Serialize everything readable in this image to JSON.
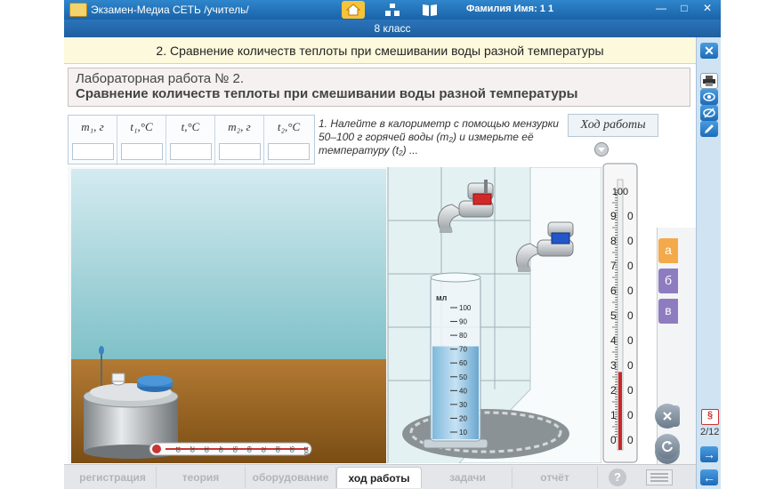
{
  "titlebar": {
    "app_title": "Экзамен-Медиа СЕТЬ /учитель/",
    "user_label": "Фамилия Имя:  1 1",
    "icons": [
      "home-icon",
      "structure-icon",
      "book-icon"
    ],
    "minimize": "—",
    "maximize": "□",
    "close": "✕"
  },
  "class_label": "8 класс",
  "topic": "2. Сравнение количеств теплоты при смешивании воды разной температуры",
  "lab": {
    "number": "Лабораторная работа № 2.",
    "title": "Сравнение количеств теплоты при смешивании воды разной температуры"
  },
  "table": {
    "headers": [
      "m₁, г",
      "t₁,°C",
      "t,°C",
      "m₂, г",
      "t₂,°C"
    ],
    "values": [
      "",
      "",
      "",
      "",
      ""
    ]
  },
  "instruction": "1. Налейте в калориметр с помощью мензурки 50–100 г горячей воды (m₂) и измерьте её температуру (t₂) ...",
  "procedure_button": "Ход работы",
  "beaker": {
    "unit": "мл",
    "scale": [
      "100",
      "90",
      "80",
      "70",
      "60",
      "50",
      "40",
      "30",
      "20",
      "10"
    ],
    "fill_level_ml": 72
  },
  "thermometer": {
    "scale": [
      "100",
      "9",
      "8",
      "7",
      "6",
      "5",
      "4",
      "3",
      "2",
      "1",
      "0"
    ],
    "reading_c": 27
  },
  "small_thermometer_scale": [
    "10",
    "20",
    "30",
    "40",
    "50",
    "60",
    "70",
    "80",
    "90",
    "100"
  ],
  "steps": [
    "а",
    "б",
    "в"
  ],
  "page_indicator": "2/12",
  "right_toolbar": [
    "close-icon",
    "print-icon",
    "eye-icon",
    "eye-off-icon",
    "pen-icon"
  ],
  "bottom_tabs": [
    {
      "label": "регистрация",
      "active": false
    },
    {
      "label": "теория",
      "active": false
    },
    {
      "label": "оборудование",
      "active": false
    },
    {
      "label": "ход работы",
      "active": true
    },
    {
      "label": "задачи",
      "active": false
    },
    {
      "label": "отчёт",
      "active": false
    }
  ],
  "colors": {
    "accent_blue": "#1c6bb8",
    "step_a": "#f4a94a",
    "step_b": "#8e7cc0",
    "step_c": "#8e7cc0",
    "topic_bg": "#fdf9dc"
  }
}
